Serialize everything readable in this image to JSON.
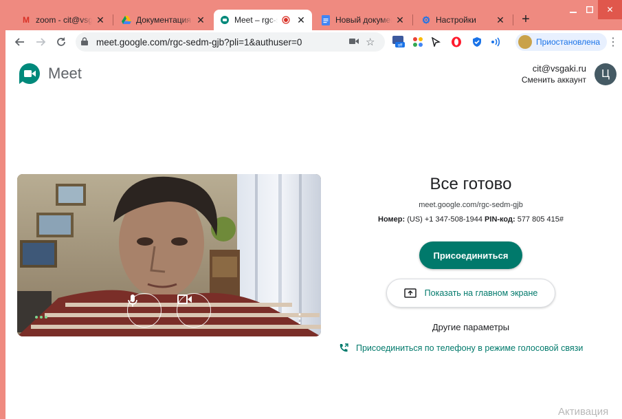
{
  "browser": {
    "tabs": [
      {
        "title": "zoom - cit@vsgaki.ru",
        "favicon": "gmail-icon",
        "active": false
      },
      {
        "title": "Документация – Google",
        "favicon": "drive-icon",
        "active": false
      },
      {
        "title": "Meet – rgc-sedm-gjb",
        "favicon": "meet-icon",
        "active": true,
        "recording_icon": "record-dot-icon"
      },
      {
        "title": "Новый документ",
        "favicon": "docs-icon",
        "active": false
      },
      {
        "title": "Настройки",
        "favicon": "settings-gear-icon",
        "active": false
      }
    ],
    "new_tab": "+",
    "address": "meet.google.com/rgc-sedm-gjb?pli=1&authuser=0",
    "profile_status": "Приостановлена",
    "accent": "#ef8a80"
  },
  "meet": {
    "app_name": "Meet",
    "account_email": "cit@vsgaki.ru",
    "switch_account": "Сменить аккаунт",
    "avatar_letter": "Ц",
    "ready_title": "Все готово",
    "meeting_url": "meet.google.com/rgc-sedm-gjb",
    "dial_label": "Номер:",
    "dial_number": " (US) +1 347-508-1944 ",
    "pin_label": "PIN-код:",
    "pin_value": " 577 805 415#",
    "join_label": "Присоединиться",
    "present_label": "Показать на главном экране",
    "other_options": "Другие параметры",
    "phone_join": "Присоединиться по телефону в режиме голосовой связи",
    "brand_color": "#00796b"
  },
  "os": {
    "watermark": "Активация"
  }
}
